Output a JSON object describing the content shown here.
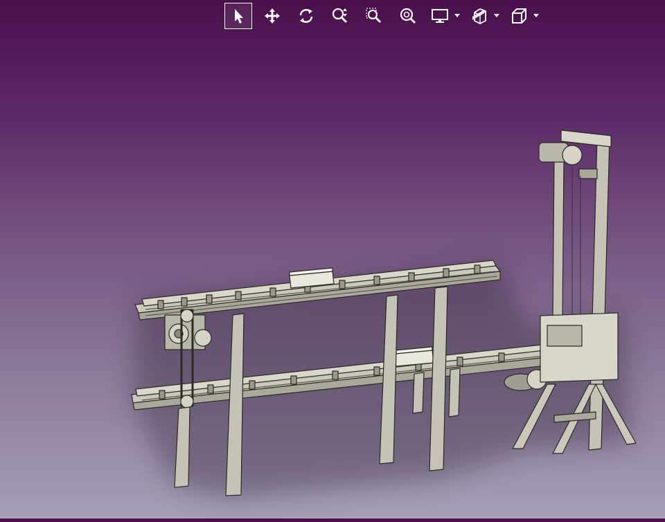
{
  "toolbar": {
    "tools": [
      {
        "id": "select",
        "icon": "pointer-arrow-icon",
        "active": true
      },
      {
        "id": "pan",
        "icon": "move-arrows-icon",
        "active": false
      },
      {
        "id": "rotate",
        "icon": "rotate-icon",
        "active": false
      },
      {
        "id": "zoom",
        "icon": "zoom-updown-icon",
        "active": false
      },
      {
        "id": "zoom-window",
        "icon": "zoom-window-icon",
        "active": false
      },
      {
        "id": "zoom-fit",
        "icon": "zoom-fit-icon",
        "active": false
      },
      {
        "id": "display",
        "icon": "monitor-icon",
        "dropdown": true
      },
      {
        "id": "section",
        "icon": "section-cut-icon",
        "dropdown": true
      },
      {
        "id": "view-cube",
        "icon": "cube-view-icon",
        "dropdown": true
      }
    ]
  },
  "scene": {
    "model": "conveyor-assembly-with-lift",
    "part_color": "#c9c8bb",
    "edge_color": "#2a2a26",
    "background_top": "#4a0f4c",
    "background_bottom": "#a49fb6"
  }
}
